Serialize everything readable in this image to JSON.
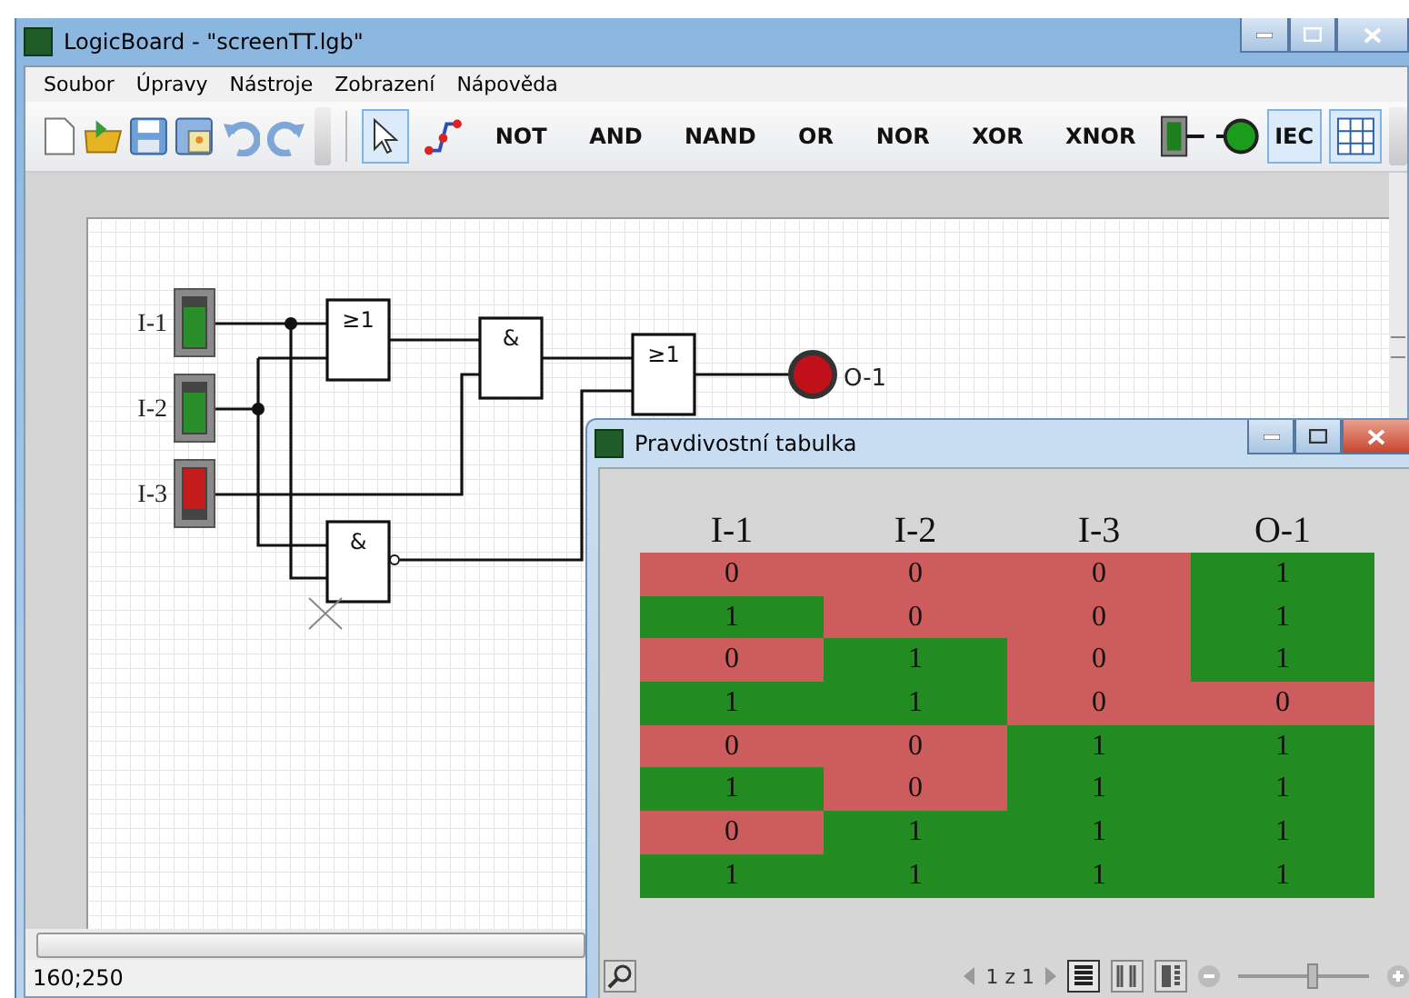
{
  "window": {
    "title": "LogicBoard - \"screenTT.lgb\""
  },
  "menu": [
    "Soubor",
    "Úpravy",
    "Nástroje",
    "Zobrazení",
    "Nápověda"
  ],
  "toolbar": [
    {
      "kind": "new"
    },
    {
      "kind": "open"
    },
    {
      "kind": "save"
    },
    {
      "kind": "export"
    },
    {
      "kind": "undo"
    },
    {
      "kind": "redo"
    },
    {
      "kind": "sep"
    },
    {
      "kind": "pointer",
      "selected": true
    },
    {
      "kind": "wire",
      "selected": false
    },
    {
      "kind": "text",
      "label": "NOT"
    },
    {
      "kind": "text",
      "label": "AND"
    },
    {
      "kind": "text",
      "label": "NAND"
    },
    {
      "kind": "text",
      "label": "OR"
    },
    {
      "kind": "text",
      "label": "NOR"
    },
    {
      "kind": "text",
      "label": "XOR"
    },
    {
      "kind": "text",
      "label": "XNOR"
    },
    {
      "kind": "switch"
    },
    {
      "kind": "lamp"
    },
    {
      "kind": "toggle",
      "label": "IEC",
      "selected": true
    },
    {
      "kind": "grid",
      "selected": true
    }
  ],
  "circuit": {
    "inputs": [
      {
        "label": "I-1",
        "on": true
      },
      {
        "label": "I-2",
        "on": true
      },
      {
        "label": "I-3",
        "on": false
      }
    ],
    "gates": [
      {
        "symbol": "≥1",
        "inverted": false
      },
      {
        "symbol": "&",
        "inverted": false
      },
      {
        "symbol": "≥1",
        "inverted": false
      },
      {
        "symbol": "&",
        "inverted": true
      }
    ],
    "outputs": [
      {
        "label": "O-1",
        "on": false
      }
    ]
  },
  "status_bar": "160;250",
  "truth_table": {
    "title": "Pravdivostní tabulka",
    "columns": [
      "I-1",
      "I-2",
      "I-3",
      "O-1"
    ],
    "rows": [
      {
        "cells": [
          {
            "text": "0",
            "on": false
          },
          {
            "text": "0",
            "on": false
          },
          {
            "text": "0",
            "on": false
          },
          {
            "text": "1",
            "on": true
          }
        ]
      },
      {
        "cells": [
          {
            "text": "1",
            "on": true
          },
          {
            "text": "0",
            "on": false
          },
          {
            "text": "0",
            "on": false
          },
          {
            "text": "1",
            "on": true
          }
        ]
      },
      {
        "cells": [
          {
            "text": "0",
            "on": false
          },
          {
            "text": "1",
            "on": true
          },
          {
            "text": "0",
            "on": false
          },
          {
            "text": "1",
            "on": true
          }
        ]
      },
      {
        "cells": [
          {
            "text": "1",
            "on": true
          },
          {
            "text": "1",
            "on": true
          },
          {
            "text": "0",
            "on": false
          },
          {
            "text": "0",
            "on": false
          }
        ]
      },
      {
        "cells": [
          {
            "text": "0",
            "on": false
          },
          {
            "text": "0",
            "on": false
          },
          {
            "text": "1",
            "on": true
          },
          {
            "text": "1",
            "on": true
          }
        ]
      },
      {
        "cells": [
          {
            "text": "1",
            "on": true
          },
          {
            "text": "0",
            "on": false
          },
          {
            "text": "1",
            "on": true
          },
          {
            "text": "1",
            "on": true
          }
        ]
      },
      {
        "cells": [
          {
            "text": "0",
            "on": false
          },
          {
            "text": "1",
            "on": true
          },
          {
            "text": "1",
            "on": true
          },
          {
            "text": "1",
            "on": true
          }
        ]
      },
      {
        "cells": [
          {
            "text": "1",
            "on": true
          },
          {
            "text": "1",
            "on": true
          },
          {
            "text": "1",
            "on": true
          },
          {
            "text": "1",
            "on": true
          }
        ]
      }
    ],
    "pager": "1 z 1",
    "views": [
      {
        "kind": "single",
        "selected": true
      },
      {
        "kind": "double",
        "selected": false
      },
      {
        "kind": "side",
        "selected": false
      }
    ],
    "zoom": {
      "level": 0.57
    }
  }
}
